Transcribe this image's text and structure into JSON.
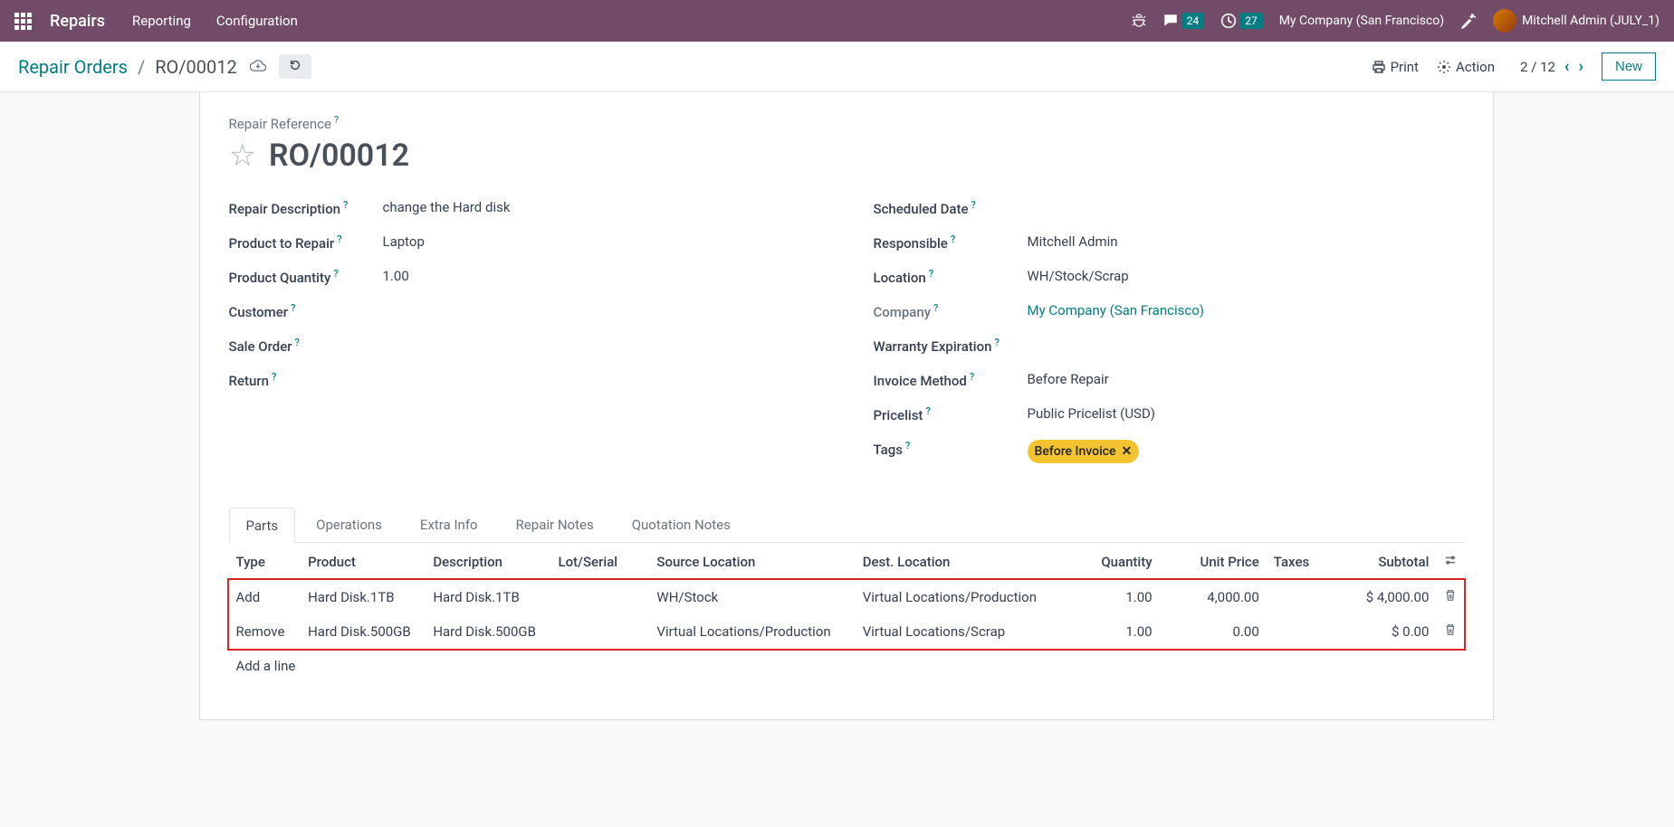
{
  "topnav": {
    "brand": "Repairs",
    "menu": [
      "Reporting",
      "Configuration"
    ],
    "messages_badge": "24",
    "activities_badge": "27",
    "company": "My Company (San Francisco)",
    "user": "Mitchell Admin (JULY_1)"
  },
  "controlbar": {
    "breadcrumb_root": "Repair Orders",
    "breadcrumb_current": "RO/00012",
    "print": "Print",
    "action": "Action",
    "pager": "2 / 12",
    "new_btn": "New"
  },
  "form": {
    "ref_label": "Repair Reference",
    "title": "RO/00012",
    "left": {
      "repair_description": {
        "label": "Repair Description",
        "value": "change the Hard disk"
      },
      "product_to_repair": {
        "label": "Product to Repair",
        "value": "Laptop"
      },
      "product_quantity": {
        "label": "Product Quantity",
        "value": "1.00"
      },
      "customer": {
        "label": "Customer",
        "value": ""
      },
      "sale_order": {
        "label": "Sale Order",
        "value": ""
      },
      "return": {
        "label": "Return",
        "value": ""
      }
    },
    "right": {
      "scheduled_date": {
        "label": "Scheduled Date",
        "value": ""
      },
      "responsible": {
        "label": "Responsible",
        "value": "Mitchell Admin"
      },
      "location": {
        "label": "Location",
        "value": "WH/Stock/Scrap"
      },
      "company": {
        "label": "Company",
        "value": "My Company (San Francisco)"
      },
      "warranty": {
        "label": "Warranty Expiration",
        "value": ""
      },
      "invoice_method": {
        "label": "Invoice Method",
        "value": "Before Repair"
      },
      "pricelist": {
        "label": "Pricelist",
        "value": "Public Pricelist (USD)"
      },
      "tags": {
        "label": "Tags",
        "value": "Before Invoice"
      }
    }
  },
  "tabs": [
    "Parts",
    "Operations",
    "Extra Info",
    "Repair Notes",
    "Quotation Notes"
  ],
  "table": {
    "headers": {
      "type": "Type",
      "product": "Product",
      "description": "Description",
      "lot": "Lot/Serial",
      "source": "Source Location",
      "dest": "Dest. Location",
      "qty": "Quantity",
      "price": "Unit Price",
      "taxes": "Taxes",
      "subtotal": "Subtotal"
    },
    "rows": [
      {
        "type": "Add",
        "product": "Hard Disk.1TB",
        "description": "Hard Disk.1TB",
        "lot": "",
        "source": "WH/Stock",
        "dest": "Virtual Locations/Production",
        "qty": "1.00",
        "price": "4,000.00",
        "taxes": "",
        "subtotal": "$ 4,000.00"
      },
      {
        "type": "Remove",
        "product": "Hard Disk.500GB",
        "description": "Hard Disk.500GB",
        "lot": "",
        "source": "Virtual Locations/Production",
        "dest": "Virtual Locations/Scrap",
        "qty": "1.00",
        "price": "0.00",
        "taxes": "",
        "subtotal": "$ 0.00"
      }
    ],
    "add_line": "Add a line"
  }
}
